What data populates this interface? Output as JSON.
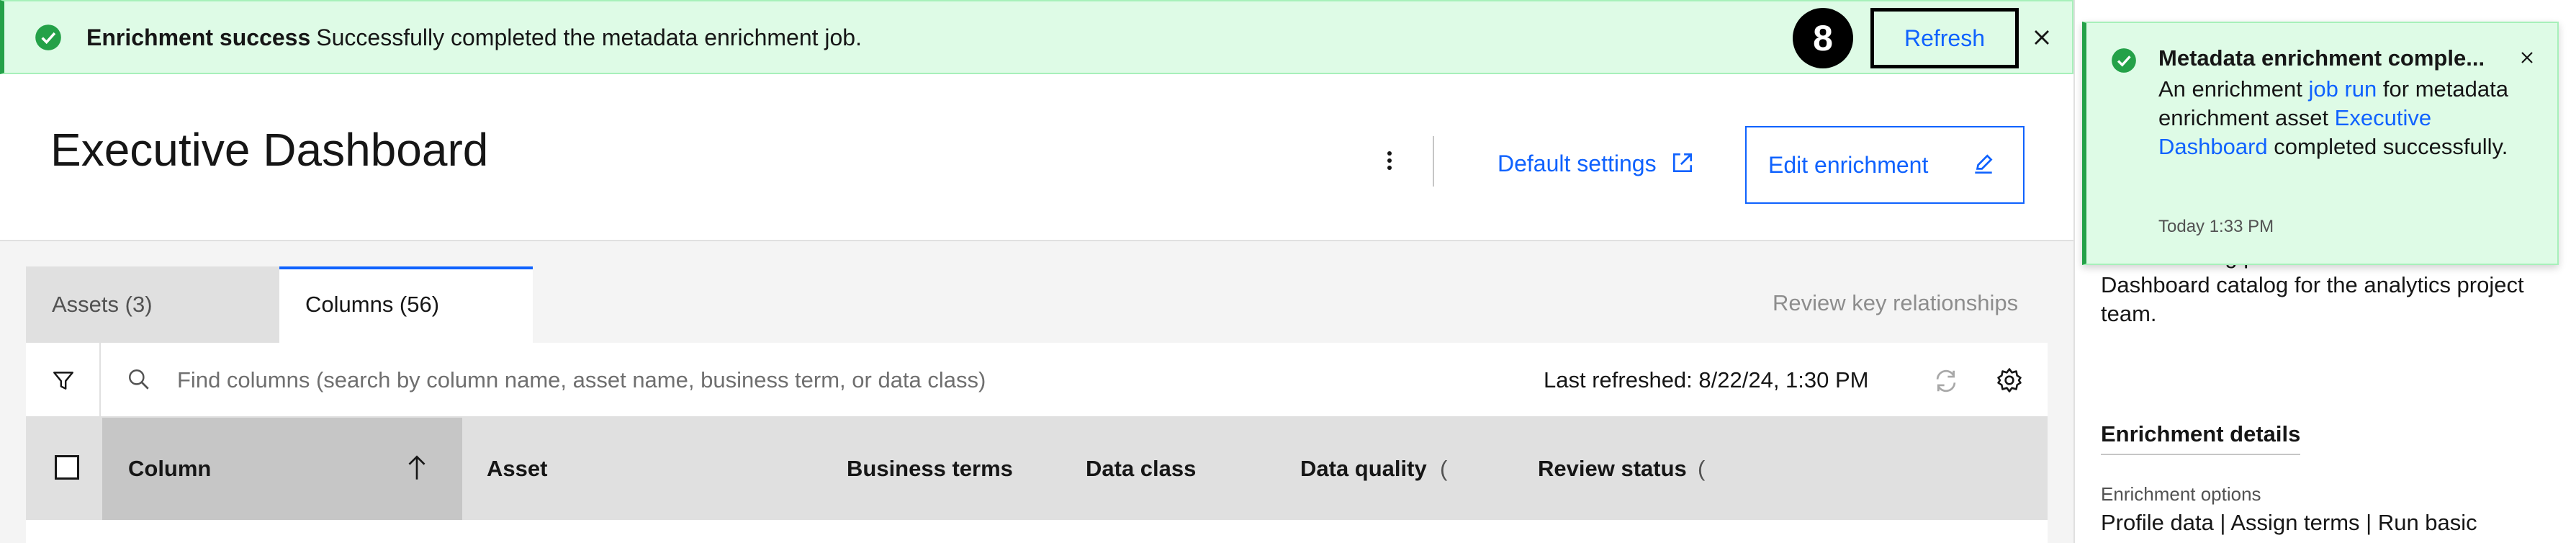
{
  "banner": {
    "title": "Enrichment success",
    "message": "Successfully completed the metadata enrichment job.",
    "step_number": "8",
    "refresh_label": "Refresh"
  },
  "header": {
    "title": "Executive Dashboard",
    "default_settings_label": "Default settings",
    "edit_enrichment_label": "Edit enrichment"
  },
  "tabs": [
    {
      "label": "Assets (3)",
      "selected": false
    },
    {
      "label": "Columns (56)",
      "selected": true
    }
  ],
  "review_key_relationships": "Review key relationships",
  "toolbar": {
    "search_placeholder": "Find columns (search by column name, asset name, business term, or data class)",
    "last_refreshed": "Last refreshed: 8/22/24, 1:30 PM"
  },
  "table": {
    "columns": [
      "Column",
      "Asset",
      "Business terms",
      "Data class",
      "Data quality",
      "Review status"
    ],
    "info_marker": "("
  },
  "side_panel": {
    "description": "that are being published to the Executive Dashboard catalog for the analytics project team.",
    "details_heading": "Enrichment details",
    "options_label": "Enrichment options",
    "options_value": "Profile data | Assign terms | Run basic"
  },
  "toast": {
    "title": "Metadata enrichment comple...",
    "body_before_link1": "An enrichment ",
    "link1": "job run",
    "body_mid": " for metadata enrichment asset ",
    "link2": "Executive Dashboard",
    "body_after": " completed successfully.",
    "time": "Today 1:33 PM"
  },
  "colors": {
    "success_green": "#24a148",
    "success_bg": "#defbe6",
    "link_blue": "#0f62fe"
  },
  "icons": [
    "checkmark-filled-icon",
    "close-icon",
    "overflow-menu-icon",
    "launch-icon",
    "edit-icon",
    "filter-icon",
    "search-icon",
    "renew-icon",
    "settings-icon",
    "arrow-up-icon"
  ]
}
